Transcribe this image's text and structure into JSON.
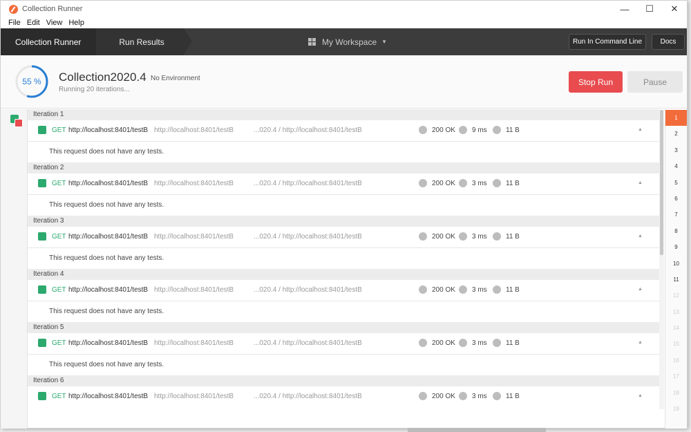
{
  "window": {
    "title": "Collection Runner",
    "minimize": "—",
    "maximize": "☐",
    "close": "✕"
  },
  "menu": [
    "File",
    "Edit",
    "View",
    "Help"
  ],
  "header": {
    "crumb_runner": "Collection Runner",
    "crumb_results": "Run Results",
    "workspace": "My Workspace",
    "btn_cli": "Run In Command Line",
    "btn_docs": "Docs"
  },
  "summary": {
    "progress_text": "55 %",
    "progress": 55,
    "collection": "Collection2020.4",
    "environment": "No Environment",
    "status": "Running 20 iterations...",
    "stop": "Stop Run",
    "pause": "Pause"
  },
  "iterations": [
    {
      "label": "Iteration 1",
      "method": "GET",
      "url": "http://localhost:8401/testB",
      "url_dim": "http://localhost:8401/testB",
      "path": "...020.4 / http://localhost:8401/testB",
      "code": "200 OK",
      "time": "9 ms",
      "size": "11 B",
      "tests": "This request does not have any tests."
    },
    {
      "label": "Iteration 2",
      "method": "GET",
      "url": "http://localhost:8401/testB",
      "url_dim": "http://localhost:8401/testB",
      "path": "...020.4 / http://localhost:8401/testB",
      "code": "200 OK",
      "time": "3 ms",
      "size": "11 B",
      "tests": "This request does not have any tests."
    },
    {
      "label": "Iteration 3",
      "method": "GET",
      "url": "http://localhost:8401/testB",
      "url_dim": "http://localhost:8401/testB",
      "path": "...020.4 / http://localhost:8401/testB",
      "code": "200 OK",
      "time": "3 ms",
      "size": "11 B",
      "tests": "This request does not have any tests."
    },
    {
      "label": "Iteration 4",
      "method": "GET",
      "url": "http://localhost:8401/testB",
      "url_dim": "http://localhost:8401/testB",
      "path": "...020.4 / http://localhost:8401/testB",
      "code": "200 OK",
      "time": "3 ms",
      "size": "11 B",
      "tests": "This request does not have any tests."
    },
    {
      "label": "Iteration 5",
      "method": "GET",
      "url": "http://localhost:8401/testB",
      "url_dim": "http://localhost:8401/testB",
      "path": "...020.4 / http://localhost:8401/testB",
      "code": "200 OK",
      "time": "3 ms",
      "size": "11 B",
      "tests": "This request does not have any tests."
    },
    {
      "label": "Iteration 6",
      "method": "GET",
      "url": "http://localhost:8401/testB",
      "url_dim": "http://localhost:8401/testB",
      "path": "...020.4 / http://localhost:8401/testB",
      "code": "200 OK",
      "time": "3 ms",
      "size": "11 B",
      "tests": ""
    }
  ],
  "iteration_nav": {
    "items": [
      "1",
      "2",
      "3",
      "4",
      "5",
      "6",
      "7",
      "8",
      "9",
      "10",
      "11",
      "12",
      "13",
      "14",
      "15",
      "16",
      "17",
      "18",
      "19"
    ],
    "active": "1",
    "completed_count": 11
  },
  "colors": {
    "accent": "#f26b3a",
    "success": "#2ca96e",
    "danger": "#e84c4f",
    "progress": "#2a7fd4"
  }
}
